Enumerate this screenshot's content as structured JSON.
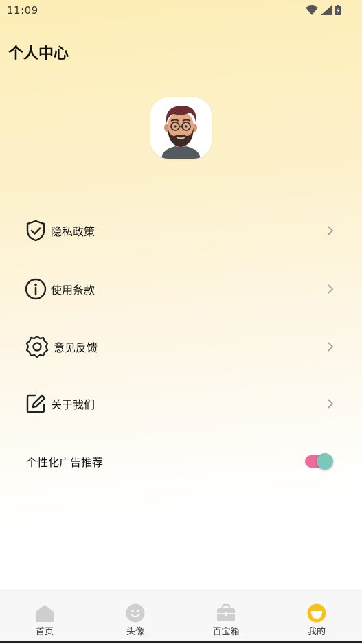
{
  "status_bar": {
    "time": "11:09"
  },
  "header": {
    "title": "个人中心"
  },
  "menu": {
    "items": [
      {
        "label": "隐私政策",
        "icon": "shield-check-icon"
      },
      {
        "label": "使用条款",
        "icon": "info-icon"
      },
      {
        "label": "意见反馈",
        "icon": "gear-icon"
      },
      {
        "label": "关于我们",
        "icon": "edit-icon"
      }
    ]
  },
  "ad_setting": {
    "label": "个性化广告推荐",
    "enabled": true
  },
  "bottom_nav": {
    "items": [
      {
        "label": "首页",
        "icon": "home-icon",
        "active": false
      },
      {
        "label": "头像",
        "icon": "smiley-icon",
        "active": false
      },
      {
        "label": "百宝箱",
        "icon": "toolbox-icon",
        "active": false
      },
      {
        "label": "我的",
        "icon": "profile-smile-icon",
        "active": true
      }
    ]
  },
  "colors": {
    "accent_active": "#f7c21b",
    "inactive_icon": "#cfcfcf",
    "toggle_track": "#f06a9a",
    "toggle_knob": "#7cc7bc"
  }
}
